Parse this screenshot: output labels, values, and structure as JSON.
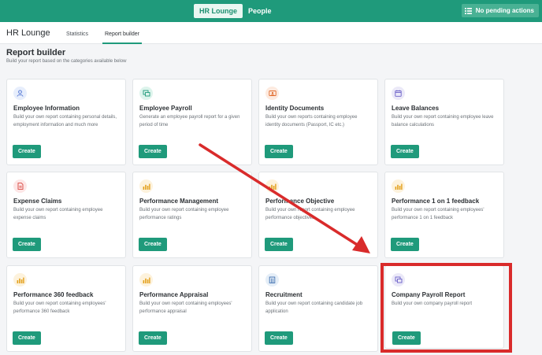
{
  "topbar": {
    "active_tab": "HR Lounge",
    "people_tab": "People",
    "pending_label": "No pending actions",
    "pending_icon": "list-icon"
  },
  "subheader": {
    "title": "HR Lounge",
    "tabs": [
      "Statistics",
      "Report builder"
    ]
  },
  "page": {
    "title": "Report builder",
    "subtitle": "Build your report based on the categories available below"
  },
  "cards": [
    {
      "title": "Employee Information",
      "desc": "Build your own report containing personal details, employment information and much more",
      "button": "Create",
      "icon": "person-icon"
    },
    {
      "title": "Employee Payroll",
      "desc": "Generate an employee payroll report for a given period of time",
      "button": "Create",
      "icon": "payroll-icon"
    },
    {
      "title": "Identity Documents",
      "desc": "Build your own reports containing employee identity documents (Passport, IC etc.)",
      "button": "Create",
      "icon": "id-card-icon"
    },
    {
      "title": "Leave Balances",
      "desc": "Build your own report containing employee leave balance calculations",
      "button": "Create",
      "icon": "calendar-icon"
    },
    {
      "title": "Expense Claims",
      "desc": "Build your own report containing employee expense claims",
      "button": "Create",
      "icon": "document-icon"
    },
    {
      "title": "Performance Management",
      "desc": "Build your own report containing employee performance ratings",
      "button": "Create",
      "icon": "bar-chart-icon"
    },
    {
      "title": "Performance Objective",
      "desc": "Build your own report containing employee performance objectives",
      "button": "Create",
      "icon": "bar-chart-icon"
    },
    {
      "title": "Performance 1 on 1 feedback",
      "desc": "Build your own report containing employees' performance 1 on 1 feedback",
      "button": "Create",
      "icon": "bar-chart-icon"
    },
    {
      "title": "Performance 360 feedback",
      "desc": "Build your own report containing employees' performance 360 feedback",
      "button": "Create",
      "icon": "bar-chart-icon"
    },
    {
      "title": "Performance Appraisal",
      "desc": "Build your own report containing employees' performance appraisal",
      "button": "Create",
      "icon": "bar-chart-icon"
    },
    {
      "title": "Recruitment",
      "desc": "Build your own report containing candidate job application",
      "button": "Create",
      "icon": "building-icon"
    },
    {
      "title": "Company Payroll Report",
      "desc": "Build your own company payroll report",
      "button": "Create",
      "icon": "payroll-icon"
    }
  ],
  "colors": {
    "brand": "#1f9a7b",
    "annotation": "#d92b2b"
  }
}
